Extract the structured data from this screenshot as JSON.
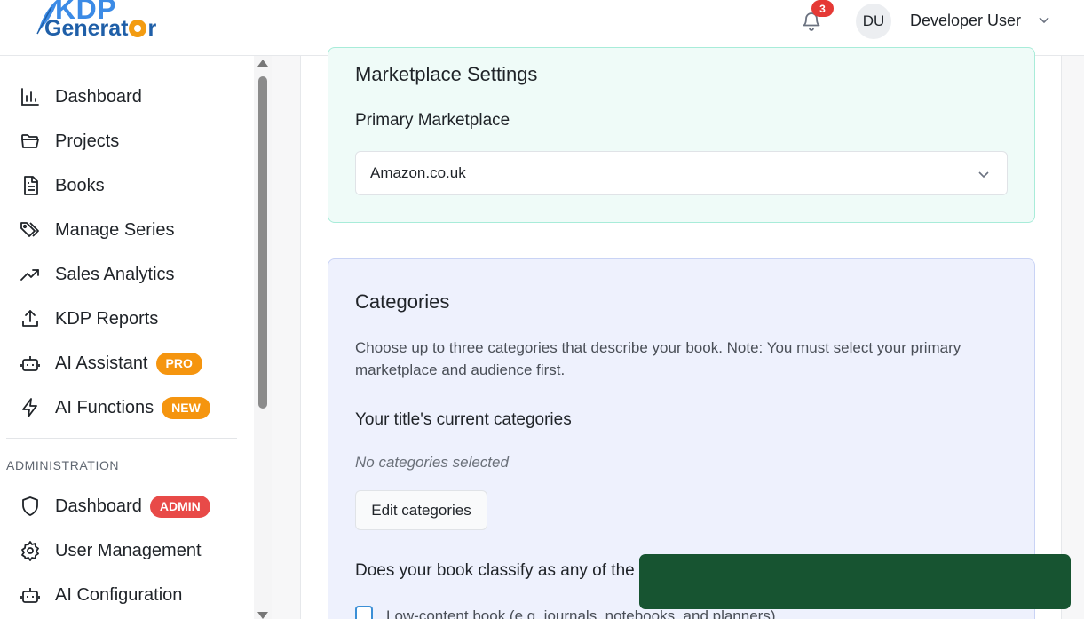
{
  "header": {
    "logo_kdp": "KDP",
    "logo_generator": "Generat",
    "logo_generator_end": "r",
    "notification_count": "3",
    "avatar_initials": "DU",
    "user_name": "Developer User"
  },
  "sidebar": {
    "items": [
      {
        "label": "Dashboard",
        "icon": "bar-chart-icon"
      },
      {
        "label": "Projects",
        "icon": "folder-icon"
      },
      {
        "label": "Books",
        "icon": "document-icon"
      },
      {
        "label": "Manage Series",
        "icon": "tags-icon"
      },
      {
        "label": "Sales Analytics",
        "icon": "trending-up-icon"
      },
      {
        "label": "KDP Reports",
        "icon": "upload-icon"
      },
      {
        "label": "AI Assistant",
        "icon": "robot-icon",
        "badge": "PRO"
      },
      {
        "label": "AI Functions",
        "icon": "lightning-icon",
        "badge": "NEW"
      }
    ],
    "section_title": "ADMINISTRATION",
    "admin_items": [
      {
        "label": "Dashboard",
        "icon": "shield-icon",
        "badge": "ADMIN"
      },
      {
        "label": "User Management",
        "icon": "gear-icon"
      },
      {
        "label": "AI Configuration",
        "icon": "robot-icon"
      }
    ]
  },
  "marketplace": {
    "title": "Marketplace Settings",
    "field_label": "Primary Marketplace",
    "selected": "Amazon.co.uk"
  },
  "categories": {
    "title": "Categories",
    "description": "Choose up to three categories that describe your book. Note: You must select your primary marketplace and audience first.",
    "current_heading": "Your title's current categories",
    "empty_text": "No categories selected",
    "edit_button": "Edit categories",
    "classify_heading": "Does your book classify as any of the",
    "low_content_label": "Low-content book (e.g. journals, notebooks, and planners)"
  },
  "colors": {
    "accent_orange": "#f5950f",
    "admin_red": "#e84a48",
    "toast_green": "#175431"
  }
}
